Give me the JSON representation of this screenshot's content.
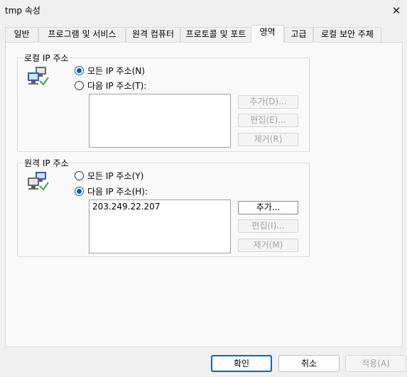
{
  "window": {
    "title": "tmp 속성"
  },
  "tabs": [
    {
      "label": "일반"
    },
    {
      "label": "프로그램 및 서비스"
    },
    {
      "label": "원격 컴퓨터"
    },
    {
      "label": "프로토콜 및 포트"
    },
    {
      "label": "영역"
    },
    {
      "label": "고급"
    },
    {
      "label": "로컬 보안 주체"
    }
  ],
  "local": {
    "title": "로컬 IP 주소",
    "radio_all": "모든 IP 주소(N)",
    "radio_these": "다음 IP 주소(T):",
    "selected": "all",
    "add": "추가(D)...",
    "edit": "편집(E)...",
    "remove": "제거(R)"
  },
  "remote": {
    "title": "원격 IP 주소",
    "radio_all": "모든 IP 주소(Y)",
    "radio_these": "다음 IP 주소(H):",
    "selected": "these",
    "addresses": [
      "203.249.22.207"
    ],
    "add": "추가...",
    "edit": "편집(I)...",
    "remove": "제거(M)"
  },
  "footer": {
    "ok": "확인",
    "cancel": "취소",
    "apply": "적용(A)"
  }
}
